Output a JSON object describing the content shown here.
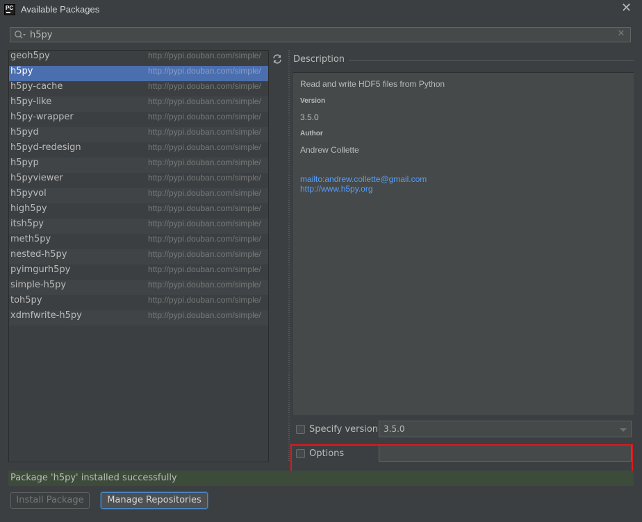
{
  "window": {
    "title": "Available Packages",
    "icon_text": "PC"
  },
  "search": {
    "value": "h5py"
  },
  "packages": [
    {
      "name": "geoh5py",
      "repo": "http://pypi.douban.com/simple/"
    },
    {
      "name": "h5py",
      "repo": "http://pypi.douban.com/simple/",
      "selected": true
    },
    {
      "name": "h5py-cache",
      "repo": "http://pypi.douban.com/simple/"
    },
    {
      "name": "h5py-like",
      "repo": "http://pypi.douban.com/simple/"
    },
    {
      "name": "h5py-wrapper",
      "repo": "http://pypi.douban.com/simple/"
    },
    {
      "name": "h5pyd",
      "repo": "http://pypi.douban.com/simple/"
    },
    {
      "name": "h5pyd-redesign",
      "repo": "http://pypi.douban.com/simple/"
    },
    {
      "name": "h5pyp",
      "repo": "http://pypi.douban.com/simple/"
    },
    {
      "name": "h5pyviewer",
      "repo": "http://pypi.douban.com/simple/"
    },
    {
      "name": "h5pyvol",
      "repo": "http://pypi.douban.com/simple/"
    },
    {
      "name": "high5py",
      "repo": "http://pypi.douban.com/simple/"
    },
    {
      "name": "itsh5py",
      "repo": "http://pypi.douban.com/simple/"
    },
    {
      "name": "meth5py",
      "repo": "http://pypi.douban.com/simple/"
    },
    {
      "name": "nested-h5py",
      "repo": "http://pypi.douban.com/simple/"
    },
    {
      "name": "pyimgurh5py",
      "repo": "http://pypi.douban.com/simple/"
    },
    {
      "name": "simple-h5py",
      "repo": "http://pypi.douban.com/simple/"
    },
    {
      "name": "toh5py",
      "repo": "http://pypi.douban.com/simple/"
    },
    {
      "name": "xdmfwrite-h5py",
      "repo": "http://pypi.douban.com/simple/"
    }
  ],
  "description": {
    "header": "Description",
    "summary": "Read and write HDF5 files from Python",
    "version_label": "Version",
    "version": "3.5.0",
    "author_label": "Author",
    "author": "Andrew Collette",
    "email_link": "mailto:andrew.collette@gmail.com",
    "home_link": "http://www.h5py.org"
  },
  "options": {
    "specify_version_label": "Specify version",
    "specify_version_checked": false,
    "version_value": "3.5.0",
    "options_label": "Options",
    "options_checked": false,
    "options_value": ""
  },
  "status": {
    "message": "Package 'h5py' installed successfully"
  },
  "buttons": {
    "install": "Install Package",
    "manage": "Manage Repositories"
  },
  "icons": {
    "app": "pycharm-icon",
    "close": "close-icon",
    "search": "search-icon",
    "clear": "clear-icon",
    "refresh": "refresh-icon"
  },
  "colors": {
    "background": "#3c3f41",
    "selection": "#4b6eaf",
    "link": "#589df6",
    "highlight_box": "#e0181c",
    "status_bg": "#3d4b3b"
  }
}
